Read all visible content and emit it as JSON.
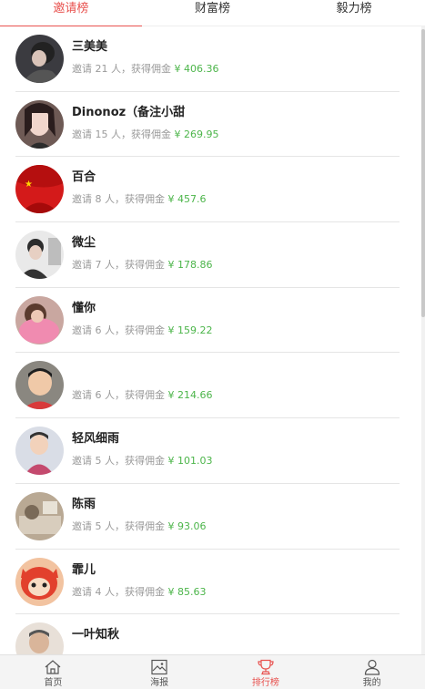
{
  "tabs": [
    {
      "label": "邀请榜",
      "active": true
    },
    {
      "label": "财富榜",
      "active": false
    },
    {
      "label": "毅力榜",
      "active": false
    }
  ],
  "stat_prefix": "邀请",
  "stat_mid": "人，获得佣金",
  "currency": "¥",
  "entries": [
    {
      "name": "三美美",
      "invites": "21",
      "amount": "406.36"
    },
    {
      "name": "Dinonoz（备注小甜",
      "invites": "15",
      "amount": "269.95"
    },
    {
      "name": "百合",
      "invites": "8",
      "amount": "457.6"
    },
    {
      "name": "微尘",
      "invites": "7",
      "amount": "178.86"
    },
    {
      "name": "懂你",
      "invites": "6",
      "amount": "159.22"
    },
    {
      "name": "",
      "invites": "6",
      "amount": "214.66"
    },
    {
      "name": "轻风细雨",
      "invites": "5",
      "amount": "101.03"
    },
    {
      "name": "陈雨",
      "invites": "5",
      "amount": "93.06"
    },
    {
      "name": "霏儿",
      "invites": "4",
      "amount": "85.63"
    },
    {
      "name": "一叶知秋",
      "invites": "",
      "amount": ""
    }
  ],
  "bottom_nav": [
    {
      "label": "首页",
      "icon": "home-icon",
      "active": false
    },
    {
      "label": "海报",
      "icon": "poster-icon",
      "active": false
    },
    {
      "label": "排行榜",
      "icon": "trophy-icon",
      "active": true
    },
    {
      "label": "我的",
      "icon": "user-icon",
      "active": false
    }
  ],
  "colors": {
    "accent": "#e8524f",
    "amount": "#4cb54a",
    "muted": "#9a9a9a"
  }
}
